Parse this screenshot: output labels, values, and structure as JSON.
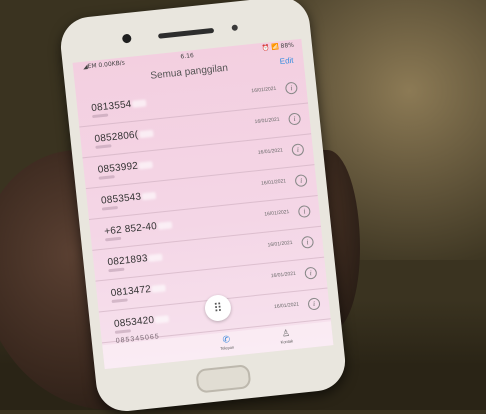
{
  "status_bar": {
    "carrier": "◢EM 0.00KB/s",
    "time": "6.16",
    "icons": "⏰ 📶 88%"
  },
  "header": {
    "title": "Semua panggilan",
    "edit_label": "Edit"
  },
  "calls": [
    {
      "number": "0813554",
      "date": "16/01/2021"
    },
    {
      "number": "0852806(",
      "date": "16/01/2021"
    },
    {
      "number": "0853992",
      "date": "16/01/2021"
    },
    {
      "number": "0853543",
      "date": "16/01/2021"
    },
    {
      "number": "+62 852-40",
      "date": "16/01/2021"
    },
    {
      "number": "0821893",
      "date": "16/01/2021"
    },
    {
      "number": "0813472",
      "date": "16/01/2021"
    },
    {
      "number": "0853420",
      "date": "16/01/2021"
    }
  ],
  "partial_row_text": "085345065",
  "info_glyph": "i",
  "dialpad_icon": "dialpad-icon",
  "dialpad_glyph": "⠿",
  "tabs": [
    {
      "label": "Telepon",
      "icon": "phone-icon",
      "glyph": "✆"
    },
    {
      "label": "Kontak",
      "icon": "person-icon",
      "glyph": "♙"
    }
  ],
  "colors": {
    "screen_tint": "#f3cfe0",
    "accent_blue": "#2b7fd9"
  }
}
